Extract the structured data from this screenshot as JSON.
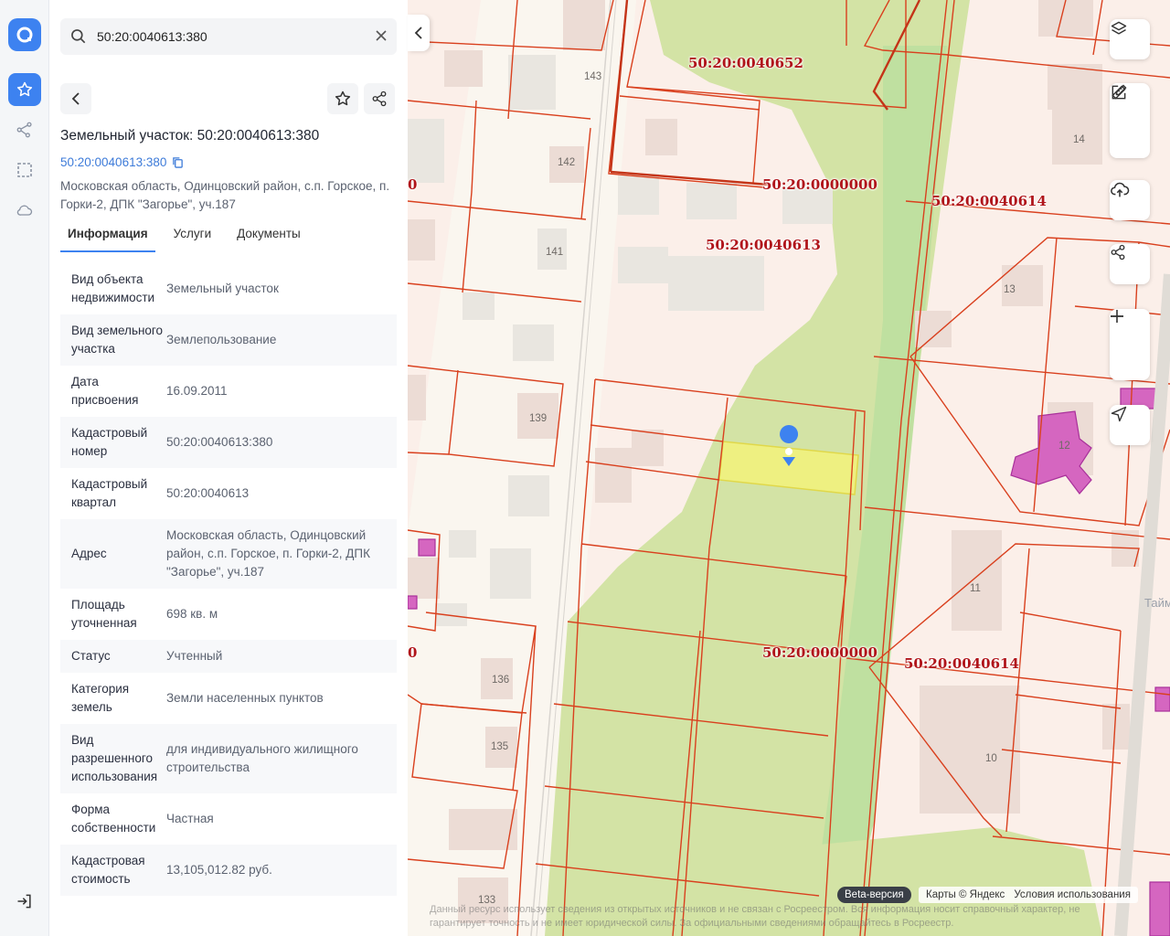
{
  "search": {
    "value": "50:20:0040613:380"
  },
  "object": {
    "title": "Земельный участок: 50:20:0040613:380",
    "cad_link": "50:20:0040613:380",
    "address": "Московская область, Одинцовский район, с.п. Горское, п. Горки-2, ДПК \"Загорье\", уч.187"
  },
  "tabs": [
    {
      "label": "Информация",
      "active": true
    },
    {
      "label": "Услуги",
      "active": false
    },
    {
      "label": "Документы",
      "active": false
    }
  ],
  "properties": [
    {
      "key": "Вид объекта недвижимости",
      "value": "Земельный участок"
    },
    {
      "key": "Вид земельного участка",
      "value": "Землепользование"
    },
    {
      "key": "Дата присвоения",
      "value": "16.09.2011"
    },
    {
      "key": "Кадастровый номер",
      "value": "50:20:0040613:380"
    },
    {
      "key": "Кадастровый квартал",
      "value": "50:20:0040613"
    },
    {
      "key": "Адрес",
      "value": "Московская область, Одинцовский район, с.п. Горское, п. Горки-2, ДПК \"Загорье\", уч.187"
    },
    {
      "key": "Площадь уточненная",
      "value": "698 кв. м"
    },
    {
      "key": "Статус",
      "value": "Учтенный"
    },
    {
      "key": "Категория земель",
      "value": "Земли населенных пунктов"
    },
    {
      "key": "Вид разрешенного использования",
      "value": "для индивидуального жилищного строительства"
    },
    {
      "key": "Форма собственности",
      "value": "Частная"
    },
    {
      "key": "Кадастровая стоимость",
      "value": "13,105,012.82 руб."
    }
  ],
  "map": {
    "cad_labels": [
      "50:20:0040652",
      "50:20:0000000",
      "50:20:0040614",
      "50:20:0040613",
      "50:20:0000000",
      "50:20:0040614",
      "0",
      "0"
    ],
    "house_numbers": [
      "143",
      "142",
      "141",
      "139",
      "136",
      "135",
      "133",
      "14",
      "13",
      "12",
      "11",
      "10"
    ],
    "street_label": "Тайм",
    "beta": "Beta-версия",
    "attribution": "Карты © Яндекс",
    "terms": "Условия использования",
    "disclaimer": "Данный ресурс использует сведения из открытых источников и не связан с Росреестром. Вся информация носит справочный характер, не гарантирует точность и не имеет юридической силы. За официальными сведениями обращайтесь в Росреестр."
  },
  "icons": [
    "logo-icon",
    "star-icon",
    "route-icon",
    "select-area-icon",
    "cloud-icon",
    "logout-icon",
    "search-icon",
    "close-icon",
    "chevron-left-icon",
    "share-icon",
    "copy-icon",
    "layers-icon",
    "ruler-icon",
    "edit-icon",
    "upload-icon",
    "plus-icon",
    "minus-icon",
    "locate-icon",
    "pin-icon"
  ],
  "colors": {
    "accent": "#3d82f0",
    "cad_label": "#b0141a",
    "boundary": "#d9401e",
    "selected_parcel": "#f2f27a",
    "green": "#d4e3a8"
  }
}
